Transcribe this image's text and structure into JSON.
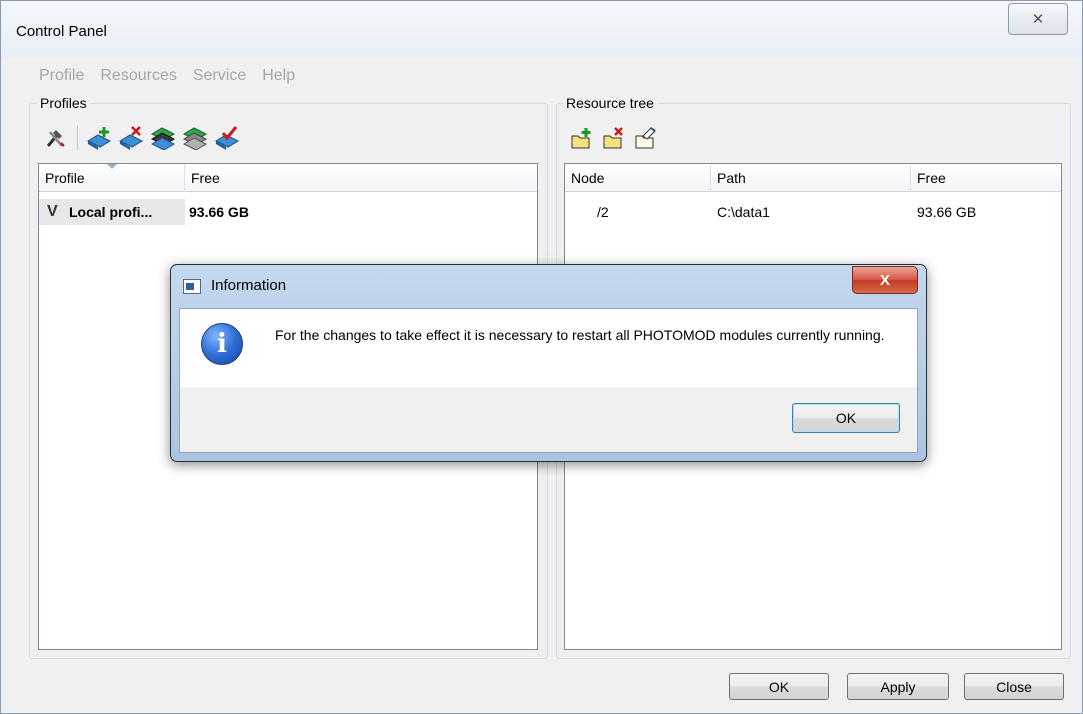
{
  "window": {
    "title": "Control Panel",
    "close_glyph": "✕"
  },
  "menu": [
    {
      "label": "Profile"
    },
    {
      "label": "Resources"
    },
    {
      "label": "Service"
    },
    {
      "label": "Help"
    }
  ],
  "profiles": {
    "group_label": "Profiles",
    "toolbar": [
      "tools-icon",
      "add-profile-icon",
      "remove-profile-icon",
      "profile-stack-icon",
      "profile-stack-gray-icon",
      "activate-profile-icon"
    ],
    "columns": [
      "Profile",
      "Free"
    ],
    "rows": [
      {
        "check": "V",
        "profile": "Local profi...",
        "free": "93.66 GB"
      }
    ]
  },
  "resources": {
    "group_label": "Resource tree",
    "toolbar": [
      "add-folder-icon",
      "remove-folder-icon",
      "edit-folder-icon"
    ],
    "columns": [
      "Node",
      "Path",
      "Free"
    ],
    "rows": [
      {
        "node": "/2",
        "path": "C:\\data1",
        "free": "93.66 GB"
      }
    ]
  },
  "buttons": {
    "ok": "OK",
    "apply": "Apply",
    "close": "Close"
  },
  "dialog": {
    "title": "Information",
    "close_glyph": "X",
    "icon": "info-icon",
    "icon_glyph": "i",
    "message": "For the changes to take effect it is necessary to restart all PHOTOMOD modules currently running.",
    "ok": "OK"
  },
  "colors": {
    "accent_blue": "#2f6fd6",
    "close_red": "#c63a24",
    "disabled_menu": "#a6a6a6"
  }
}
